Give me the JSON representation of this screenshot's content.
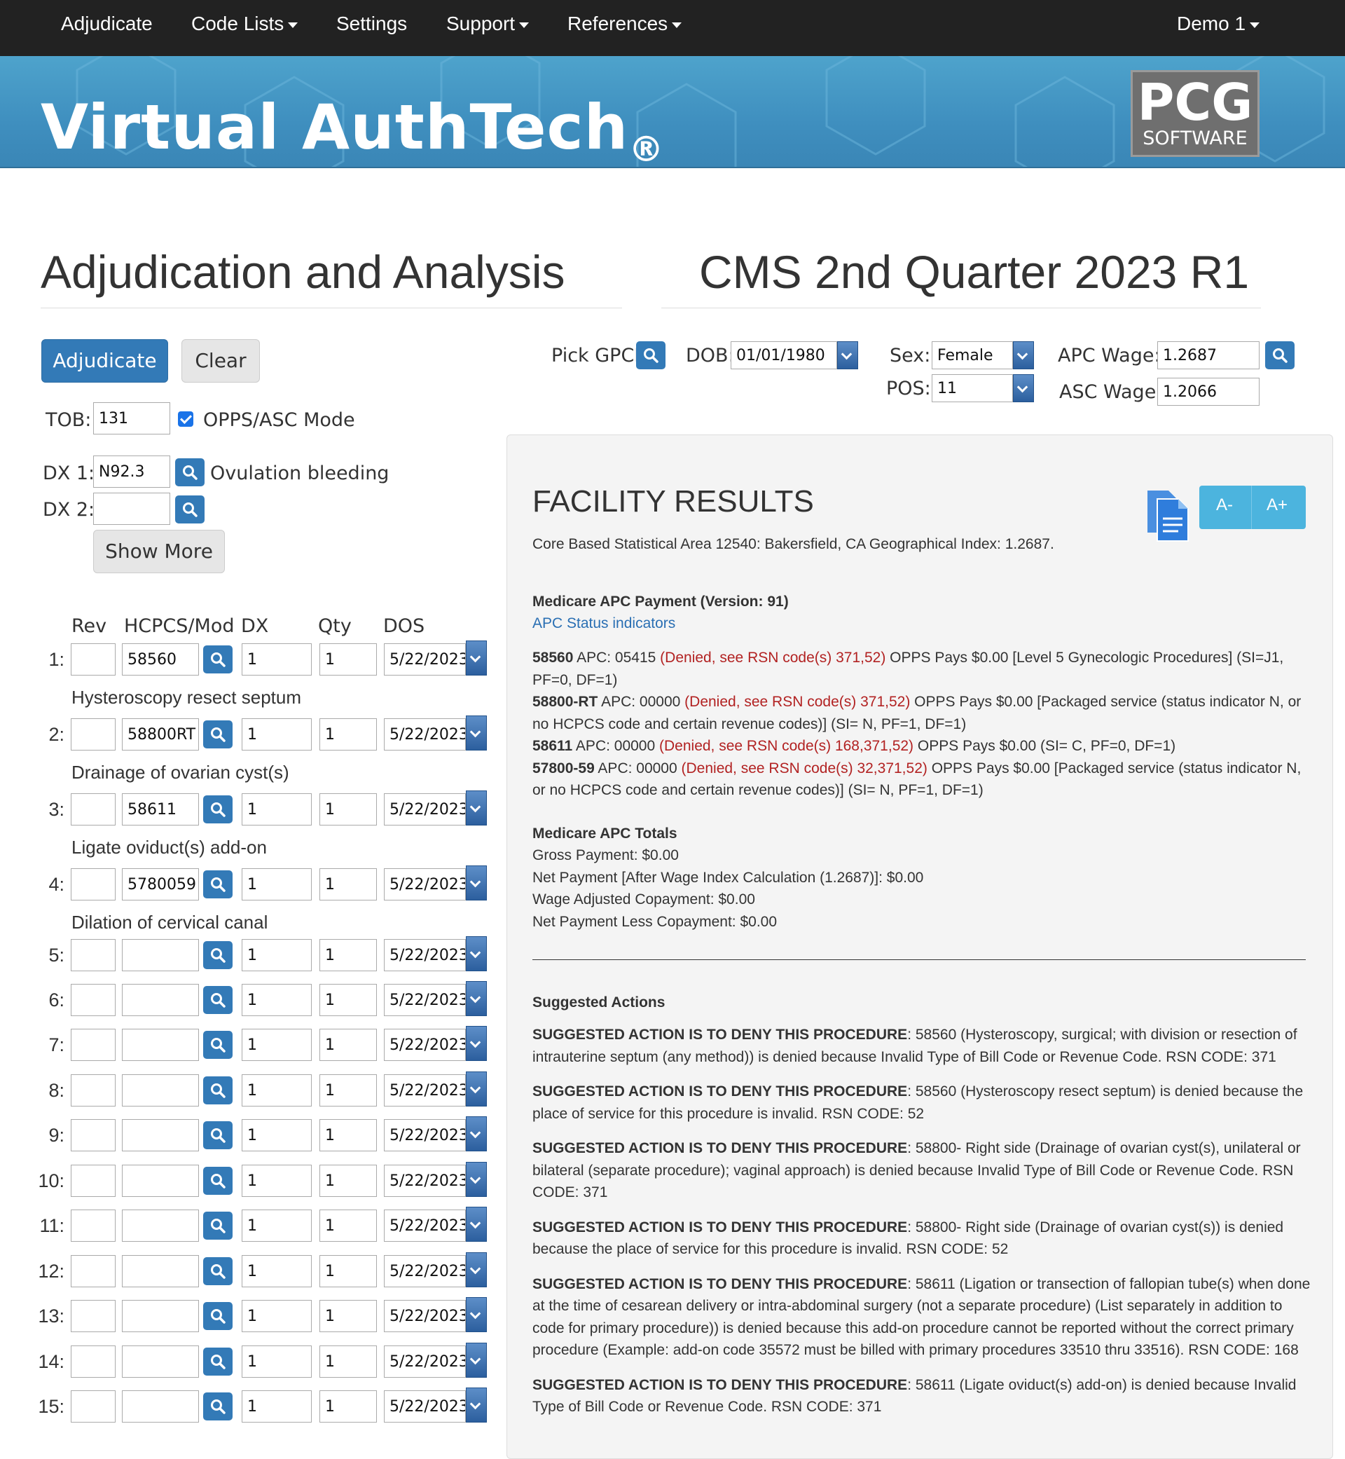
{
  "nav": {
    "items": [
      "Adjudicate",
      "Code Lists",
      "Settings",
      "Support",
      "References"
    ],
    "user": "Demo 1"
  },
  "banner": {
    "brand": "Virtual AuthTech",
    "registered": "®",
    "logo_big": "PCG",
    "logo_small": "SOFTWARE"
  },
  "page": {
    "title": "Adjudication and Analysis",
    "version": "CMS 2nd Quarter 2023 R1"
  },
  "buttons": {
    "adjudicate": "Adjudicate",
    "clear": "Clear",
    "show_more": "Show More"
  },
  "form": {
    "tob_label": "TOB:",
    "tob": "131",
    "opps_label": "OPPS/ASC Mode",
    "dx1_label": "DX 1:",
    "dx1": "N92.3",
    "dx1_desc": "Ovulation bleeding",
    "dx2_label": "DX 2:",
    "dx2": "",
    "pick_gpci": "Pick GPCI",
    "dob_label": "DOB:",
    "dob": "01/01/1980",
    "sex_label": "Sex:",
    "sex": "Female",
    "pos_label": "POS:",
    "pos": "11",
    "apc_wage_label": "APC Wage:",
    "apc_wage": "1.2687",
    "asc_wage_label": "ASC Wage:",
    "asc_wage": "1.2066"
  },
  "lines": {
    "headers": [
      "Rev",
      "HCPCS/Mod",
      "DX",
      "Qty",
      "DOS"
    ],
    "rows": [
      {
        "n": "1:",
        "rev": "",
        "hcpcs": "58560",
        "dx": "1",
        "qty": "1",
        "dos": "5/22/2023",
        "desc": "Hysteroscopy resect septum"
      },
      {
        "n": "2:",
        "rev": "",
        "hcpcs": "58800RT",
        "dx": "1",
        "qty": "1",
        "dos": "5/22/2023",
        "desc": "Drainage of ovarian cyst(s)"
      },
      {
        "n": "3:",
        "rev": "",
        "hcpcs": "58611",
        "dx": "1",
        "qty": "1",
        "dos": "5/22/2023",
        "desc": "Ligate oviduct(s) add-on"
      },
      {
        "n": "4:",
        "rev": "",
        "hcpcs": "5780059",
        "dx": "1",
        "qty": "1",
        "dos": "5/22/2023",
        "desc": "Dilation of cervical canal"
      },
      {
        "n": "5:",
        "rev": "",
        "hcpcs": "",
        "dx": "1",
        "qty": "1",
        "dos": "5/22/2023",
        "desc": ""
      },
      {
        "n": "6:",
        "rev": "",
        "hcpcs": "",
        "dx": "1",
        "qty": "1",
        "dos": "5/22/2023",
        "desc": ""
      },
      {
        "n": "7:",
        "rev": "",
        "hcpcs": "",
        "dx": "1",
        "qty": "1",
        "dos": "5/22/2023",
        "desc": ""
      },
      {
        "n": "8:",
        "rev": "",
        "hcpcs": "",
        "dx": "1",
        "qty": "1",
        "dos": "5/22/2023",
        "desc": ""
      },
      {
        "n": "9:",
        "rev": "",
        "hcpcs": "",
        "dx": "1",
        "qty": "1",
        "dos": "5/22/2023",
        "desc": ""
      },
      {
        "n": "10:",
        "rev": "",
        "hcpcs": "",
        "dx": "1",
        "qty": "1",
        "dos": "5/22/2023",
        "desc": ""
      },
      {
        "n": "11:",
        "rev": "",
        "hcpcs": "",
        "dx": "1",
        "qty": "1",
        "dos": "5/22/2023",
        "desc": ""
      },
      {
        "n": "12:",
        "rev": "",
        "hcpcs": "",
        "dx": "1",
        "qty": "1",
        "dos": "5/22/2023",
        "desc": ""
      },
      {
        "n": "13:",
        "rev": "",
        "hcpcs": "",
        "dx": "1",
        "qty": "1",
        "dos": "5/22/2023",
        "desc": ""
      },
      {
        "n": "14:",
        "rev": "",
        "hcpcs": "",
        "dx": "1",
        "qty": "1",
        "dos": "5/22/2023",
        "desc": ""
      },
      {
        "n": "15:",
        "rev": "",
        "hcpcs": "",
        "dx": "1",
        "qty": "1",
        "dos": "5/22/2023",
        "desc": ""
      }
    ]
  },
  "results": {
    "title": "FACILITY RESULTS",
    "font_dec": "A-",
    "font_inc": "A+",
    "cbsa": "Core Based Statistical Area 12540: Bakersfield, CA Geographical Index: 1.2687.",
    "apc_heading": "Medicare APC Payment (Version: 91)",
    "status_link": "APC Status indicators",
    "apc_lines": [
      {
        "code": "58560",
        "pre": " APC: 05415 ",
        "denied": "(Denied, see RSN code(s) 371,52)",
        "post": " OPPS Pays $0.00 [Level 5 Gynecologic Procedures] (SI=J1, PF=0, DF=1)"
      },
      {
        "code": "58800-RT",
        "pre": " APC: 00000 ",
        "denied": "(Denied, see RSN code(s) 371,52)",
        "post": " OPPS Pays $0.00 [Packaged service (status indicator N, or no HCPCS code and certain revenue codes)] (SI= N, PF=1, DF=1)"
      },
      {
        "code": "58611",
        "pre": " APC: 00000 ",
        "denied": "(Denied, see RSN code(s) 168,371,52)",
        "post": " OPPS Pays $0.00 (SI= C, PF=0, DF=1)"
      },
      {
        "code": "57800-59",
        "pre": " APC: 00000 ",
        "denied": "(Denied, see RSN code(s) 32,371,52)",
        "post": " OPPS Pays $0.00 [Packaged service (status indicator N, or no HCPCS code and certain revenue codes)] (SI= N, PF=1, DF=1)"
      }
    ],
    "totals_heading": "Medicare APC Totals",
    "totals": [
      "Gross Payment: $0.00",
      "Net Payment [After Wage Index Calculation (1.2687)]: $0.00",
      "Wage Adjusted Copayment: $0.00",
      "Net Payment Less Copayment: $0.00"
    ],
    "suggested_heading": "Suggested Actions",
    "suggested_prefix": "SUGGESTED ACTION IS TO DENY THIS PROCEDURE",
    "suggested": [
      ": 58560 (Hysteroscopy, surgical; with division or resection of intrauterine septum (any method)) is denied because Invalid Type of Bill Code or Revenue Code. RSN CODE: 371",
      ": 58560 (Hysteroscopy resect septum) is denied because the place of service for this procedure is invalid. RSN CODE: 52",
      ": 58800- Right side (Drainage of ovarian cyst(s), unilateral or bilateral (separate procedure); vaginal approach) is denied because Invalid Type of Bill Code or Revenue Code. RSN CODE: 371",
      ": 58800- Right side (Drainage of ovarian cyst(s)) is denied because the place of service for this procedure is invalid. RSN CODE: 52",
      ": 58611 (Ligation or transection of fallopian tube(s) when done at the time of cesarean delivery or intra-abdominal surgery (not a separate procedure) (List separately in addition to code for primary procedure)) is denied because this add-on procedure cannot be reported without the correct primary procedure (Example: add-on code 35572 must be billed with primary procedures 33510 thru 33516). RSN CODE: 168",
      ": 58611 (Ligate oviduct(s) add-on) is denied because Invalid Type of Bill Code or Revenue Code. RSN CODE: 371"
    ]
  }
}
